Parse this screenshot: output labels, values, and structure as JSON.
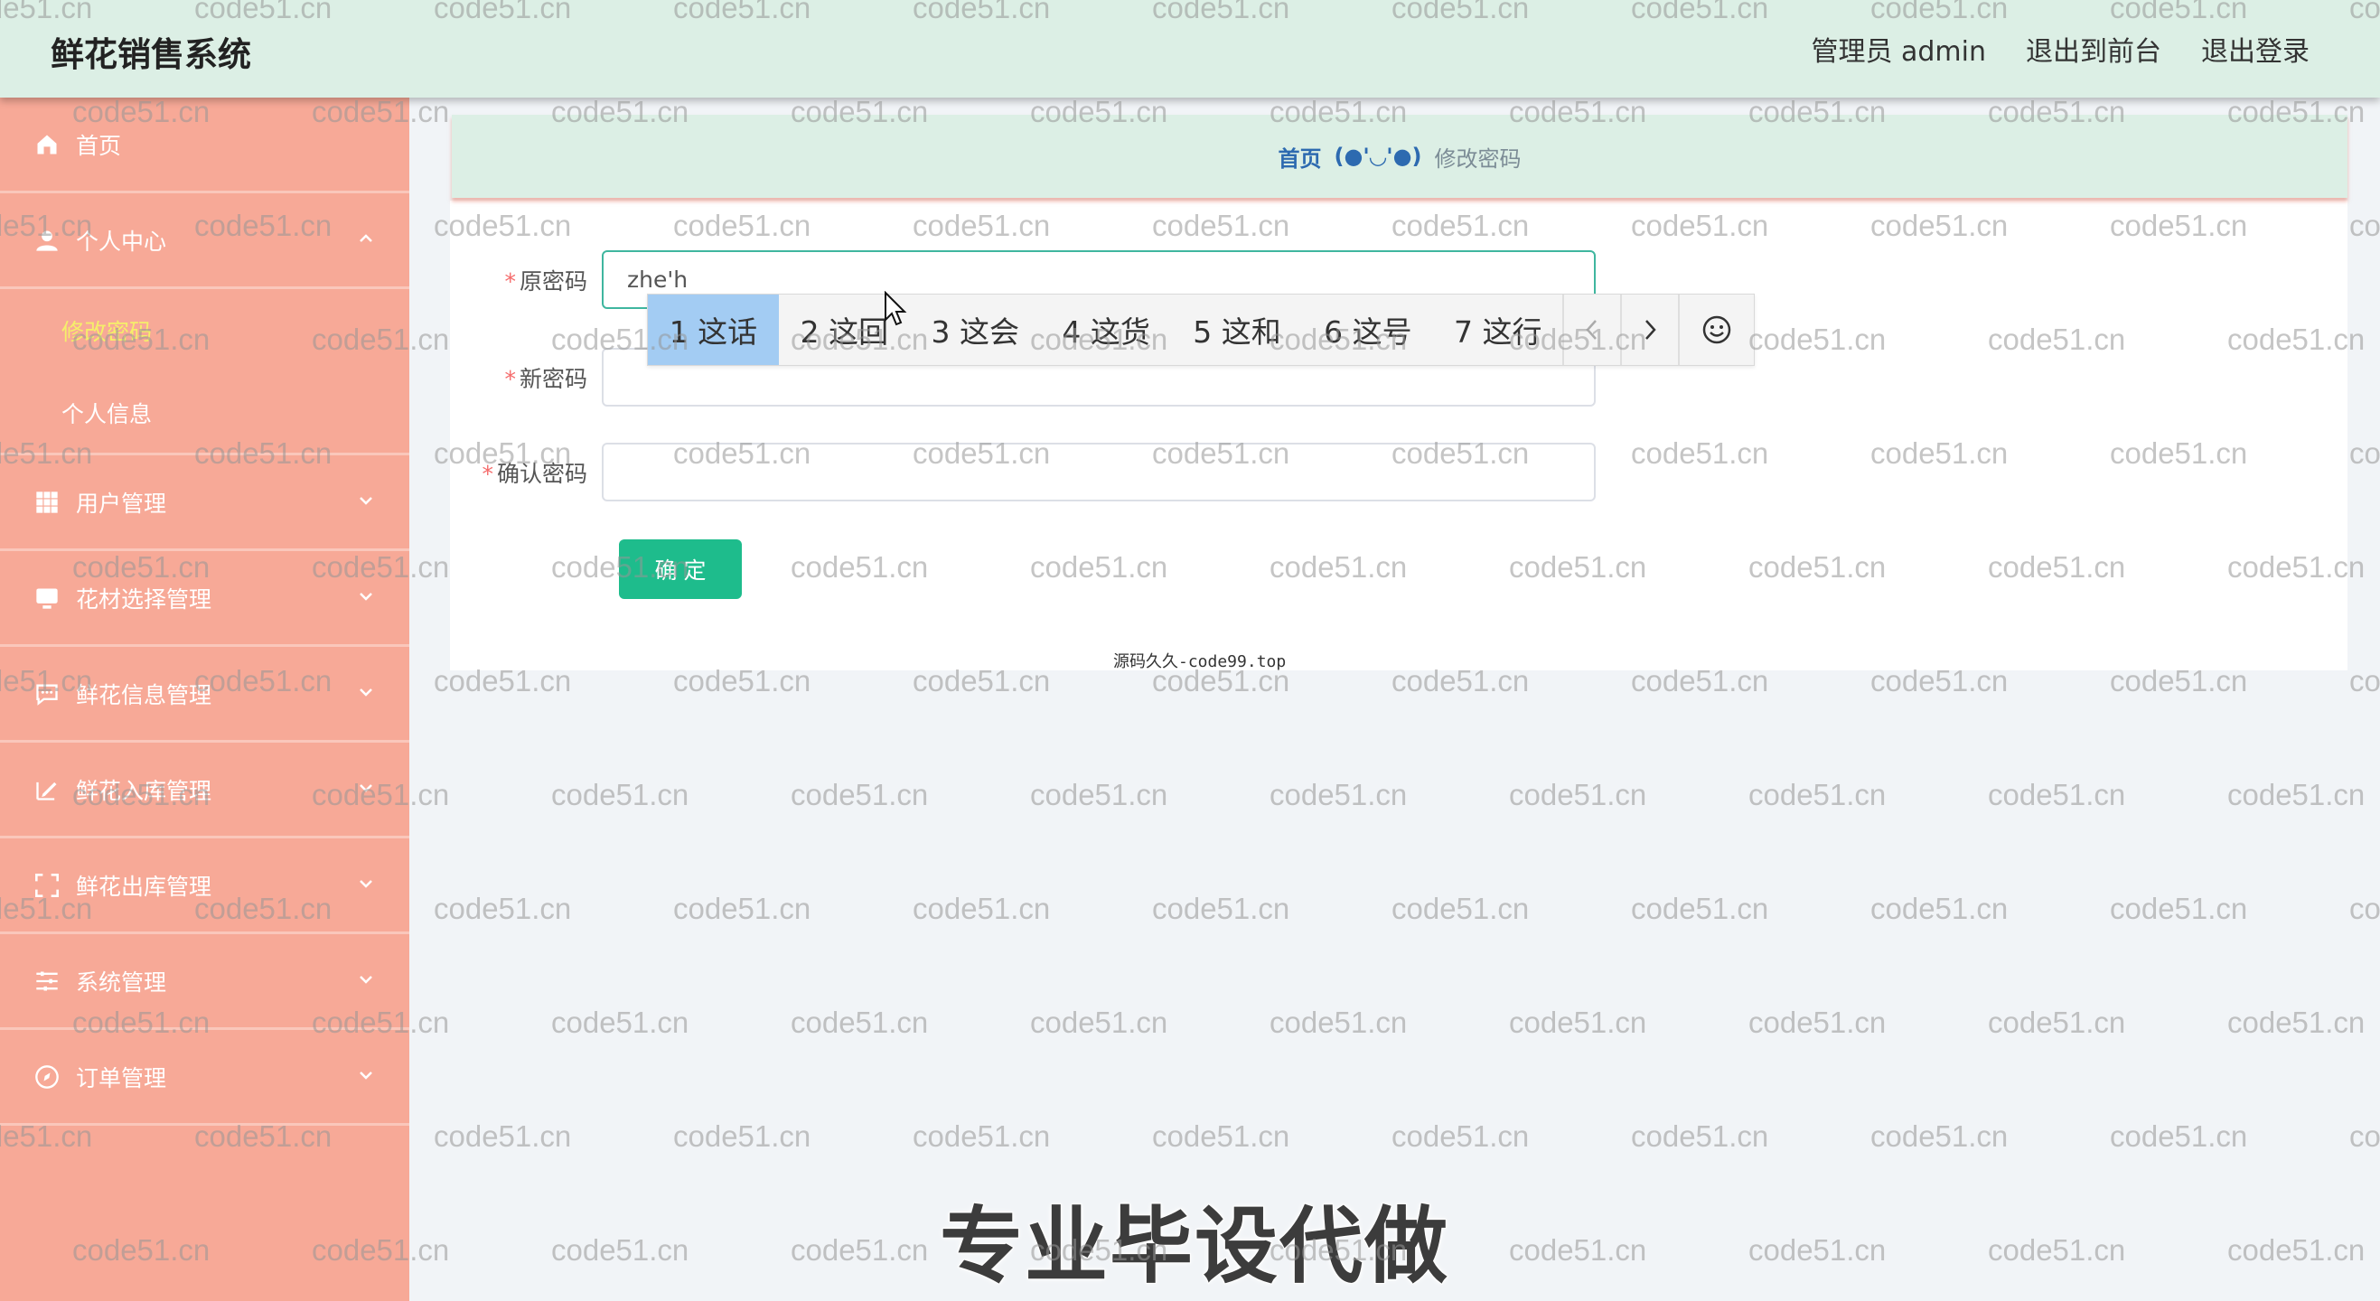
{
  "header": {
    "app_title": "鲜花销售系统",
    "admin_label": "管理员 admin",
    "to_front_label": "退出到前台",
    "logout_label": "退出登录"
  },
  "sidebar": {
    "items": [
      {
        "label": "首页",
        "icon": "home-icon"
      },
      {
        "label": "个人中心",
        "icon": "user-icon"
      },
      {
        "label": "用户管理",
        "icon": "grid-icon"
      },
      {
        "label": "花材选择管理",
        "icon": "monitor-icon"
      },
      {
        "label": "鲜花信息管理",
        "icon": "chat-icon"
      },
      {
        "label": "鲜花入库管理",
        "icon": "edit-icon"
      },
      {
        "label": "鲜花出库管理",
        "icon": "frame-icon"
      },
      {
        "label": "系统管理",
        "icon": "sliders-icon"
      },
      {
        "label": "订单管理",
        "icon": "compass-icon"
      }
    ],
    "submenu": [
      {
        "label": "修改密码",
        "active": true
      },
      {
        "label": "个人信息",
        "active": false
      }
    ]
  },
  "breadcrumb": {
    "home": "首页",
    "separator": "(●'◡'●)",
    "current": "修改密码"
  },
  "form": {
    "old_password_label": "原密码",
    "old_password_value": "zhe'h",
    "new_password_label": "新密码",
    "new_password_value": "",
    "confirm_password_label": "确认密码",
    "confirm_password_value": "",
    "required_mark": "*",
    "submit_label": "确 定"
  },
  "ime": {
    "candidates": [
      "1 这话",
      "2 这回",
      "3 这会",
      "4 这货",
      "5 这和",
      "6 这号",
      "7 这行"
    ],
    "selected_index": 0,
    "prev_icon": "chevron-left-icon",
    "next_icon": "chevron-right-icon",
    "emoji_icon": "smiley-icon"
  },
  "footer_note": "源码久久-code99.top",
  "overlay_caption": "专业毕设代做",
  "watermark_text": "code51.cn",
  "colors": {
    "header_bg": "#dcefe5",
    "sidebar_bg": "#f7a997",
    "active_submenu": "#f5ef6a",
    "primary_button": "#1ebc8c",
    "breadcrumb_link": "#2d6ab0",
    "ime_selected": "#a3ccf3"
  }
}
